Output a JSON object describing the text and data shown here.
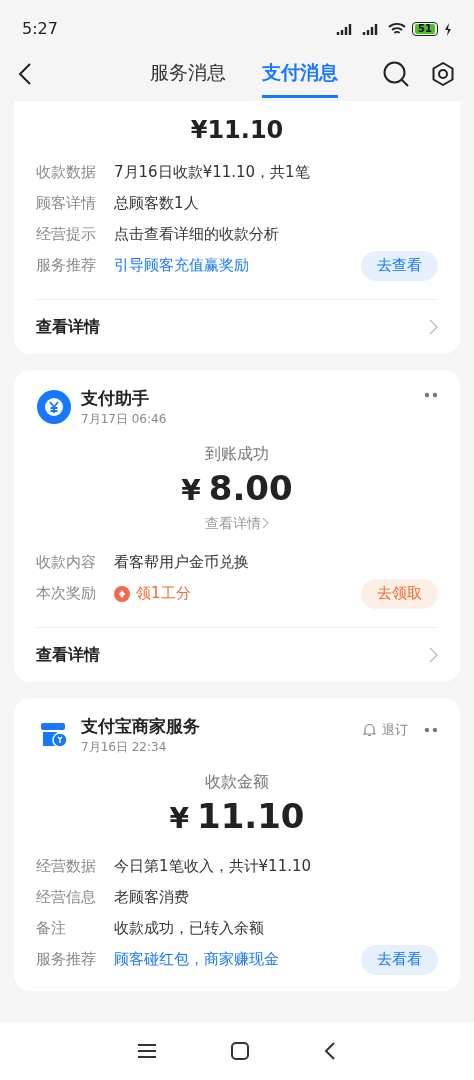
{
  "status_bar": {
    "time": "5:27",
    "battery": "51"
  },
  "header": {
    "tabs": [
      {
        "label": "服务消息",
        "selected": false
      },
      {
        "label": "支付消息",
        "selected": true
      }
    ]
  },
  "cards": [
    {
      "summary": {
        "amount": "¥11.10",
        "kind": "medium"
      },
      "rows": [
        {
          "label": "收款数据",
          "value": "7月16日收款¥11.10，共1笔",
          "kind": "text"
        },
        {
          "label": "顾客详情",
          "value": "总顾客数1人",
          "kind": "text"
        },
        {
          "label": "经营提示",
          "value": "点击查看详细的收款分析",
          "kind": "text"
        },
        {
          "label": "服务推荐",
          "value": "引导顾客充值赢奖励",
          "kind": "link",
          "action": {
            "label": "去查看",
            "kind": "primary"
          }
        }
      ],
      "footer": "查看详情"
    },
    {
      "header": {
        "name": "支付助手",
        "time": "7月17日 06:46",
        "kind": "coin"
      },
      "summary": {
        "label": "到账成功",
        "currency": "¥",
        "amount": "8.00",
        "kind": "large",
        "link": "查看详情"
      },
      "rows": [
        {
          "label": "收款内容",
          "value": "看客帮用户金币兑换",
          "kind": "text"
        },
        {
          "label": "本次奖励",
          "value": "领1工分",
          "kind": "reward",
          "action": {
            "label": "去领取",
            "kind": "reward"
          }
        }
      ],
      "footer": "查看详情"
    },
    {
      "header": {
        "name": "支付宝商家服务",
        "time": "7月16日 22:34",
        "kind": "shop",
        "unsubscribe": "退订"
      },
      "summary": {
        "label": "收款金额",
        "currency": "¥",
        "amount": "11.10",
        "kind": "large"
      },
      "rows": [
        {
          "label": "经营数据",
          "value": "今日第1笔收入，共计¥11.10",
          "kind": "text"
        },
        {
          "label": "经营信息",
          "value": "老顾客消费",
          "kind": "text"
        },
        {
          "label": "备注",
          "value": "收款成功，已转入余额",
          "kind": "text"
        },
        {
          "label": "服务推荐",
          "value": "顾客碰红包，商家赚现金",
          "kind": "link",
          "action": {
            "label": "去看看",
            "kind": "primary"
          }
        }
      ]
    }
  ]
}
